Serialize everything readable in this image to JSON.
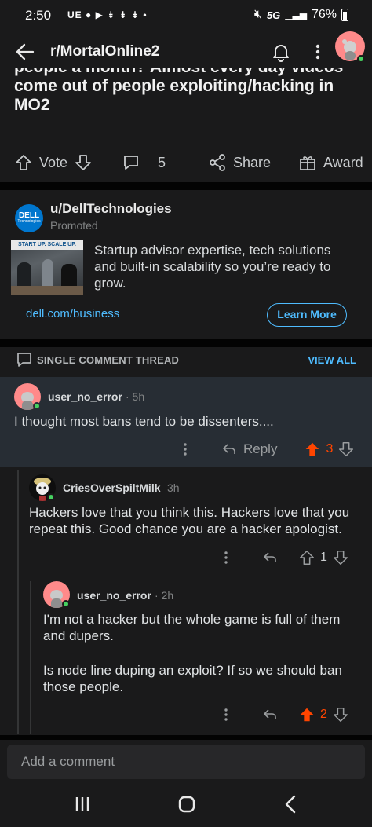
{
  "status_bar": {
    "time": "2:50",
    "notif": "UE",
    "network": "5G",
    "battery": "76%"
  },
  "header": {
    "title": "r/MortalOnline2"
  },
  "post": {
    "title_partial": "people a month? Almost every day videos",
    "title_line2": "come out of people exploiting/hacking in",
    "title_line3": "MO2",
    "vote_label": "Vote",
    "comment_count": "5",
    "share_label": "Share",
    "award_label": "Award"
  },
  "ad": {
    "logo_text": "DELL",
    "logo_sub": "Technologies",
    "user": "u/DellTechnologies",
    "promoted": "Promoted",
    "image_caption": "START UP. SCALE UP.",
    "body": "Startup advisor expertise, tech solutions and built-in scalability so you’re ready to grow.",
    "link": "dell.com/business",
    "cta": "Learn More"
  },
  "thread": {
    "label": "SINGLE COMMENT THREAD",
    "view_all": "VIEW ALL"
  },
  "comments": [
    {
      "user": "user_no_error",
      "age": "· 5h",
      "text": "I thought most bans tend to be dissenters....",
      "reply_label": "Reply",
      "score": "3",
      "upvoted": true
    },
    {
      "user": "CriesOverSpiltMilk",
      "age": "3h",
      "text": "Hackers love that you think this. Hackers love that you repeat this. Good chance you are a hacker apologist.",
      "score": "1",
      "upvoted": false
    },
    {
      "user": "user_no_error",
      "age": "· 2h",
      "text_p1": "I'm not a hacker but the whole game is full of them and dupers.",
      "text_p2": "Is node line duping an exploit? If so we should ban those people.",
      "score": "2",
      "upvoted": true
    }
  ],
  "composer": {
    "placeholder": "Add a comment"
  },
  "colors": {
    "upvote": "#ff4500",
    "link": "#4fbcff",
    "highlight_bg": "#272d34"
  }
}
